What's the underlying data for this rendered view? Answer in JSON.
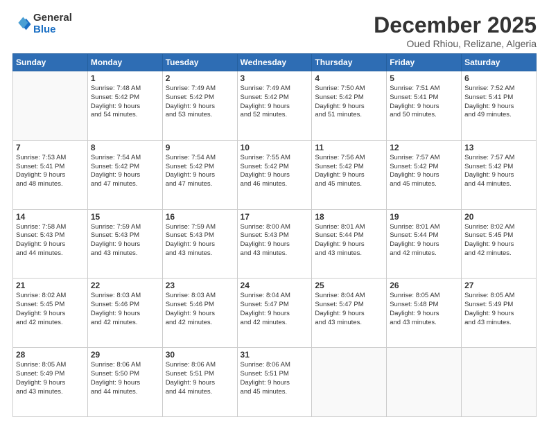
{
  "logo": {
    "general": "General",
    "blue": "Blue"
  },
  "title": "December 2025",
  "subtitle": "Oued Rhiou, Relizane, Algeria",
  "days_header": [
    "Sunday",
    "Monday",
    "Tuesday",
    "Wednesday",
    "Thursday",
    "Friday",
    "Saturday"
  ],
  "weeks": [
    [
      {
        "day": "",
        "info": ""
      },
      {
        "day": "1",
        "info": "Sunrise: 7:48 AM\nSunset: 5:42 PM\nDaylight: 9 hours\nand 54 minutes."
      },
      {
        "day": "2",
        "info": "Sunrise: 7:49 AM\nSunset: 5:42 PM\nDaylight: 9 hours\nand 53 minutes."
      },
      {
        "day": "3",
        "info": "Sunrise: 7:49 AM\nSunset: 5:42 PM\nDaylight: 9 hours\nand 52 minutes."
      },
      {
        "day": "4",
        "info": "Sunrise: 7:50 AM\nSunset: 5:42 PM\nDaylight: 9 hours\nand 51 minutes."
      },
      {
        "day": "5",
        "info": "Sunrise: 7:51 AM\nSunset: 5:41 PM\nDaylight: 9 hours\nand 50 minutes."
      },
      {
        "day": "6",
        "info": "Sunrise: 7:52 AM\nSunset: 5:41 PM\nDaylight: 9 hours\nand 49 minutes."
      }
    ],
    [
      {
        "day": "7",
        "info": "Sunrise: 7:53 AM\nSunset: 5:41 PM\nDaylight: 9 hours\nand 48 minutes."
      },
      {
        "day": "8",
        "info": "Sunrise: 7:54 AM\nSunset: 5:42 PM\nDaylight: 9 hours\nand 47 minutes."
      },
      {
        "day": "9",
        "info": "Sunrise: 7:54 AM\nSunset: 5:42 PM\nDaylight: 9 hours\nand 47 minutes."
      },
      {
        "day": "10",
        "info": "Sunrise: 7:55 AM\nSunset: 5:42 PM\nDaylight: 9 hours\nand 46 minutes."
      },
      {
        "day": "11",
        "info": "Sunrise: 7:56 AM\nSunset: 5:42 PM\nDaylight: 9 hours\nand 45 minutes."
      },
      {
        "day": "12",
        "info": "Sunrise: 7:57 AM\nSunset: 5:42 PM\nDaylight: 9 hours\nand 45 minutes."
      },
      {
        "day": "13",
        "info": "Sunrise: 7:57 AM\nSunset: 5:42 PM\nDaylight: 9 hours\nand 44 minutes."
      }
    ],
    [
      {
        "day": "14",
        "info": "Sunrise: 7:58 AM\nSunset: 5:43 PM\nDaylight: 9 hours\nand 44 minutes."
      },
      {
        "day": "15",
        "info": "Sunrise: 7:59 AM\nSunset: 5:43 PM\nDaylight: 9 hours\nand 43 minutes."
      },
      {
        "day": "16",
        "info": "Sunrise: 7:59 AM\nSunset: 5:43 PM\nDaylight: 9 hours\nand 43 minutes."
      },
      {
        "day": "17",
        "info": "Sunrise: 8:00 AM\nSunset: 5:43 PM\nDaylight: 9 hours\nand 43 minutes."
      },
      {
        "day": "18",
        "info": "Sunrise: 8:01 AM\nSunset: 5:44 PM\nDaylight: 9 hours\nand 43 minutes."
      },
      {
        "day": "19",
        "info": "Sunrise: 8:01 AM\nSunset: 5:44 PM\nDaylight: 9 hours\nand 42 minutes."
      },
      {
        "day": "20",
        "info": "Sunrise: 8:02 AM\nSunset: 5:45 PM\nDaylight: 9 hours\nand 42 minutes."
      }
    ],
    [
      {
        "day": "21",
        "info": "Sunrise: 8:02 AM\nSunset: 5:45 PM\nDaylight: 9 hours\nand 42 minutes."
      },
      {
        "day": "22",
        "info": "Sunrise: 8:03 AM\nSunset: 5:46 PM\nDaylight: 9 hours\nand 42 minutes."
      },
      {
        "day": "23",
        "info": "Sunrise: 8:03 AM\nSunset: 5:46 PM\nDaylight: 9 hours\nand 42 minutes."
      },
      {
        "day": "24",
        "info": "Sunrise: 8:04 AM\nSunset: 5:47 PM\nDaylight: 9 hours\nand 42 minutes."
      },
      {
        "day": "25",
        "info": "Sunrise: 8:04 AM\nSunset: 5:47 PM\nDaylight: 9 hours\nand 43 minutes."
      },
      {
        "day": "26",
        "info": "Sunrise: 8:05 AM\nSunset: 5:48 PM\nDaylight: 9 hours\nand 43 minutes."
      },
      {
        "day": "27",
        "info": "Sunrise: 8:05 AM\nSunset: 5:49 PM\nDaylight: 9 hours\nand 43 minutes."
      }
    ],
    [
      {
        "day": "28",
        "info": "Sunrise: 8:05 AM\nSunset: 5:49 PM\nDaylight: 9 hours\nand 43 minutes."
      },
      {
        "day": "29",
        "info": "Sunrise: 8:06 AM\nSunset: 5:50 PM\nDaylight: 9 hours\nand 44 minutes."
      },
      {
        "day": "30",
        "info": "Sunrise: 8:06 AM\nSunset: 5:51 PM\nDaylight: 9 hours\nand 44 minutes."
      },
      {
        "day": "31",
        "info": "Sunrise: 8:06 AM\nSunset: 5:51 PM\nDaylight: 9 hours\nand 45 minutes."
      },
      {
        "day": "",
        "info": ""
      },
      {
        "day": "",
        "info": ""
      },
      {
        "day": "",
        "info": ""
      }
    ]
  ]
}
